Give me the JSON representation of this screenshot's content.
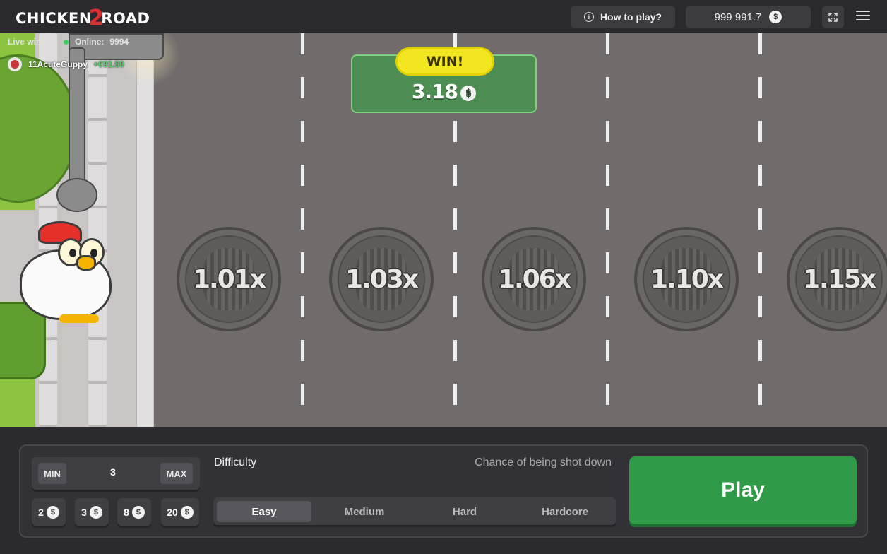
{
  "header": {
    "logo_text_1": "CHICKEN",
    "logo_text_2": "2",
    "logo_text_3": "ROAD",
    "how_to_play_label": "How to play?",
    "balance": "999 991.7",
    "currency_symbol": "$"
  },
  "live": {
    "label": "Live wins:",
    "online_label": "Online:",
    "online_count": "9994",
    "winner_name": "11AcuteGuppy",
    "winner_amount": "+€91.50"
  },
  "win": {
    "label": "WIN!",
    "amount": "3.18"
  },
  "lanes": [
    {
      "multiplier": "1.01x"
    },
    {
      "multiplier": "1.03x"
    },
    {
      "multiplier": "1.06x"
    },
    {
      "multiplier": "1.10x"
    },
    {
      "multiplier": "1.15x"
    }
  ],
  "bet": {
    "min_label": "MIN",
    "max_label": "MAX",
    "value": "3",
    "quick_amounts": [
      "2",
      "3",
      "8",
      "20"
    ]
  },
  "difficulty": {
    "label": "Difficulty",
    "chance_label": "Chance of being shot down",
    "options": [
      "Easy",
      "Medium",
      "Hard",
      "Hardcore"
    ],
    "selected": "Easy"
  },
  "play_label": "Play",
  "colors": {
    "play_green": "#2f9a48",
    "win_yellow": "#f2e620",
    "road": "#716c6b"
  }
}
